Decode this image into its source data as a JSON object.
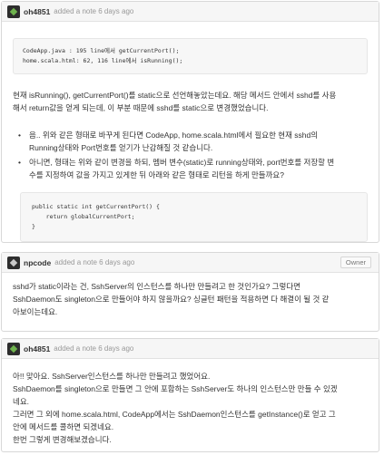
{
  "notes": [
    {
      "author": "oh4851",
      "meta": "added a note 6 days ago",
      "code1": [
        "CodeApp.java : 195 line에서 getCurrentPort();",
        "home.scala.html: 62, 116 line에서 isRunning();"
      ],
      "paragraph": [
        "현재 isRunning(), getCurrentPort()를 static으로 선언해놓았는데요. 해당 메서드 안에서 sshd를 사용",
        "해서 return값을 얻게 되는데, 이 부분 때문에 sshd를 static으로 변경했었습니다."
      ],
      "bullets": [
        [
          "음.. 위와 같은 형태로 바꾸게 된다면 CodeApp, home.scala.html에서 필요한 현재 sshd의",
          "Running상태와 Port번호를 얻기가 난감해질 것 같습니다."
        ],
        [
          "아니면, 형태는 위와 같이 변경을 하되, 멤버 변수(static)로 running상태와, port번호를 저장할 변",
          "수를 지정하여 값을 가지고 있게한 뒤 아래와 같은 형태로 리턴을 하게 만들까요?"
        ]
      ],
      "code2": [
        "public static int getCurrentPort() {",
        "    return globalCurrentPort;",
        "}"
      ]
    },
    {
      "author": "npcode",
      "meta": "added a note 6 days ago",
      "badge": "Owner",
      "paragraph": [
        "sshd가 static이라는 건, SshServer의 인스턴스를 하나만 만들려고 한 것인가요? 그렇다면",
        "SshDaemon도 singleton으로 만들어야 하지 않을까요? 싱글턴 패턴을 적용하면 다 해결이 될 것 같",
        "아보이는데요."
      ]
    },
    {
      "author": "oh4851",
      "meta": "added a note 6 days ago",
      "paragraph": [
        "아!! 맞아요. SshServer인스턴스를 하나만 만들려고 했었어요.",
        "SshDaemon를 singleton으로 만들면 그 안에 포함하는 SshServer도 하나의 인스턴스만 만들 수 있겠",
        "네요.",
        "그러면 그 외에 home.scala.html, CodeApp에서는 SshDaemon인스턴스를 getInstance()로 얻고 그",
        "안에 메서드를 콜하면 되겠네요.",
        "한번 그렇게 변경해보겠습니다."
      ]
    }
  ]
}
